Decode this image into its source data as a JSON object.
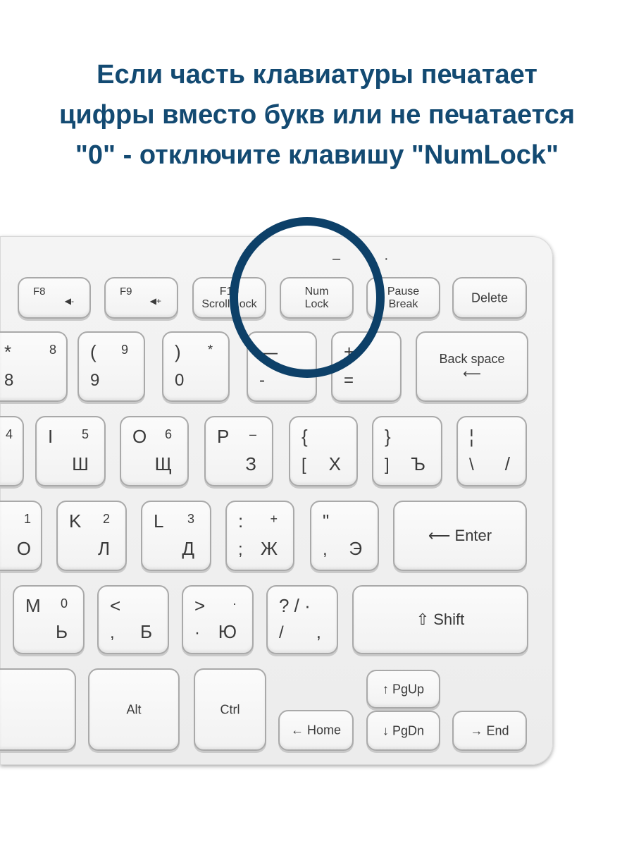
{
  "headline": {
    "lines": [
      "Если часть клавиатуры печатает",
      "цифры вместо букв или не печатается",
      "\"0\" - отключите клавишу \"NumLock\""
    ],
    "color": "#134a72"
  },
  "highlight": {
    "target": "Num Lock",
    "color": "#0d4068"
  },
  "indicators": {
    "led1": "–",
    "led2": "·"
  },
  "keys": {
    "f8": {
      "tl": "F8",
      "br": "◀-"
    },
    "f9": {
      "tl": "F9",
      "br": "◀+"
    },
    "f10": {
      "c": "F10\nScroll Lock"
    },
    "numlock": {
      "c": "Num\nLock"
    },
    "pause": {
      "c": "Pause\nBreak"
    },
    "delete": {
      "c": "Delete"
    },
    "k8": {
      "tl": "*",
      "tr": "8",
      "bl": "8"
    },
    "k9": {
      "tl": "(",
      "tr": "9",
      "bl": "9"
    },
    "k0": {
      "tl": ")",
      "tr": "*",
      "bl": "0"
    },
    "minus": {
      "tl": "—",
      "bl": "-"
    },
    "plus": {
      "tl": "+",
      "bl": "="
    },
    "backspace": {
      "c": "Back space\n⟵"
    },
    "k4": {
      "tr": "4"
    },
    "i": {
      "tl": "I",
      "tr": "5",
      "br": "Ш"
    },
    "o": {
      "tl": "O",
      "tr": "6",
      "br": "Щ"
    },
    "p": {
      "tl": "P",
      "tr": "–",
      "br": "З"
    },
    "lbracket": {
      "tl": "{",
      "bl": "[",
      "br": "Х"
    },
    "rbracket": {
      "tl": "}",
      "bl": "]",
      "br": "Ъ"
    },
    "backslash": {
      "tl": "¦",
      "bl": "\\",
      "br": "/"
    },
    "j": {
      "tr": "1",
      "br": "О"
    },
    "k": {
      "tl": "K",
      "tr": "2",
      "br": "Л"
    },
    "l": {
      "tl": "L",
      "tr": "3",
      "br": "Д"
    },
    "semicolon": {
      "tl": ":",
      "tr": "+",
      "bl": ";",
      "br": "Ж"
    },
    "quote": {
      "tl": "\"",
      "bl": ",",
      "br": "Э"
    },
    "enter": {
      "c": "⟵ Enter"
    },
    "m": {
      "tl": "M",
      "tr": "0",
      "br": "Ь"
    },
    "comma": {
      "tl": "<",
      "bl": ",",
      "br": "Б"
    },
    "period": {
      "tl": ">",
      "tr": "·",
      "bl": "·",
      "br": "Ю"
    },
    "slash": {
      "tl": "? / ·",
      "bl": "/",
      "br": ","
    },
    "shift": {
      "c": "⇧ Shift"
    },
    "space": {
      "c": ""
    },
    "alt": {
      "c": "Alt"
    },
    "ctrl": {
      "c": "Ctrl"
    },
    "home": {
      "c": "← Home"
    },
    "pgup": {
      "c": "↑ PgUp"
    },
    "pgdn": {
      "c": "↓ PgDn"
    },
    "end": {
      "c": "→ End"
    }
  }
}
